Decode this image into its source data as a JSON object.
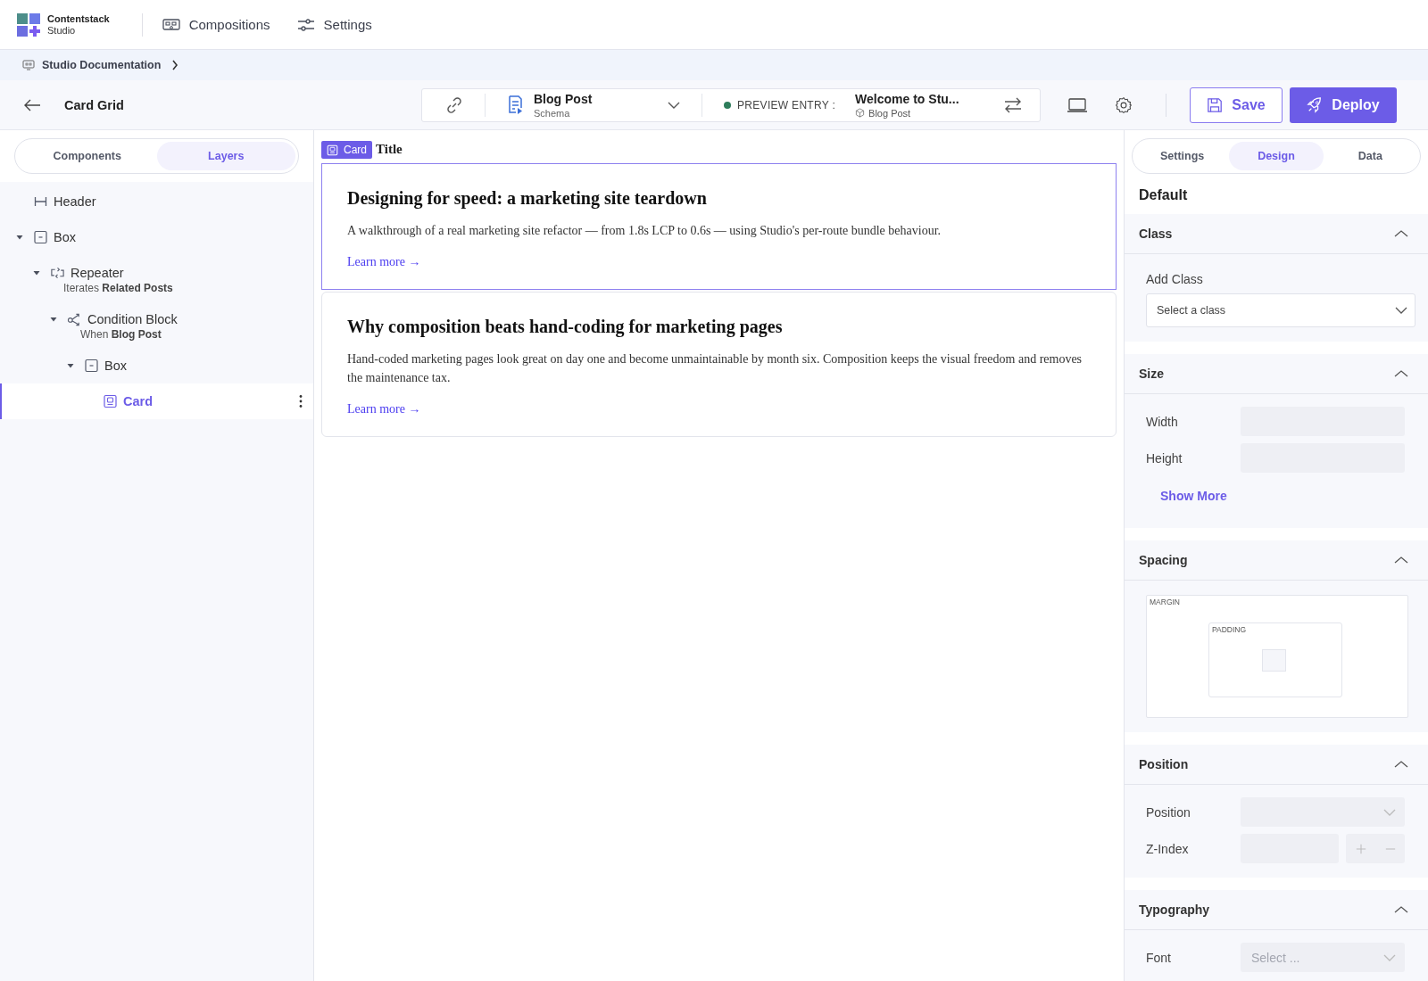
{
  "topnav": {
    "logo": {
      "name": "Contentstack",
      "product": "Studio"
    },
    "items": [
      {
        "label": "Compositions",
        "kind": "compositions"
      },
      {
        "label": "Settings",
        "kind": "settings"
      }
    ]
  },
  "breadcrumb": {
    "label": "Studio Documentation"
  },
  "toolbar": {
    "title": "Card Grid",
    "schema": {
      "name": "Blog Post",
      "type": "Schema"
    },
    "preview": {
      "label": "PREVIEW ENTRY :",
      "entry": "Welcome to Stu...",
      "type": "Blog Post"
    },
    "buttons": [
      {
        "label": "Save",
        "kind": "secondary"
      },
      {
        "label": "Deploy",
        "kind": "primary"
      }
    ]
  },
  "left_panel": {
    "tabs": [
      {
        "label": "Components",
        "selected": false
      },
      {
        "label": "Layers",
        "selected": true
      }
    ],
    "layers": [
      {
        "label": "Header",
        "kind": "header",
        "selected": false
      },
      {
        "label": "Box",
        "kind": "box",
        "selected": false,
        "expanded": true,
        "children": [
          {
            "label": "Repeater",
            "kind": "repeater",
            "selected": false,
            "expanded": true,
            "subtitle": "Iterates **Related Posts**",
            "children": [
              {
                "label": "Condition Block",
                "kind": "condition",
                "selected": false,
                "expanded": true,
                "subtitle": "When **Blog Post**",
                "children": [
                  {
                    "label": "Box",
                    "kind": "box",
                    "selected": false,
                    "expanded": true,
                    "children": [
                      {
                        "label": "Card",
                        "kind": "card",
                        "selected": true
                      }
                    ]
                  }
                ]
              }
            ]
          }
        ]
      }
    ]
  },
  "canvas": {
    "heading": "Title",
    "badge": "Card",
    "cards": [
      {
        "title": "Designing for speed: a marketing site teardown",
        "body": "A walkthrough of a real marketing site refactor — from 1.8s LCP to 0.6s — using Studio's per-route bundle behaviour.",
        "link": "Learn more →",
        "selected": true
      },
      {
        "title": "Why composition beats hand-coding for marketing pages",
        "body": "Hand-coded marketing pages look great on day one and become unmaintainable by month six. Composition keeps the visual freedom and removes the maintenance tax.",
        "link": "Learn more →",
        "selected": false
      }
    ]
  },
  "right_panel": {
    "tabs": [
      {
        "label": "Settings",
        "selected": false
      },
      {
        "label": "Design",
        "selected": true
      },
      {
        "label": "Data",
        "selected": false
      }
    ],
    "state": "Default",
    "sections": [
      {
        "title": "Class",
        "expanded": true,
        "fields": [
          {
            "kind": "select",
            "label": "Add Class",
            "placeholder": "Select a class"
          }
        ]
      },
      {
        "title": "Size",
        "expanded": true,
        "fields": [
          {
            "kind": "input",
            "label": "Width"
          },
          {
            "kind": "input",
            "label": "Height"
          },
          {
            "kind": "link",
            "label": "Show More"
          }
        ]
      },
      {
        "title": "Spacing",
        "expanded": true,
        "fields": [
          {
            "kind": "box_model",
            "outer": "MARGIN",
            "inner": "PADDING"
          }
        ]
      },
      {
        "title": "Position",
        "expanded": true,
        "fields": [
          {
            "kind": "select_inline",
            "label": "Position"
          },
          {
            "kind": "stepper",
            "label": "Z-Index"
          }
        ]
      },
      {
        "title": "Typography",
        "expanded": true,
        "fields": [
          {
            "kind": "select_inline",
            "label": "Font",
            "placeholder": "Select ..."
          }
        ]
      }
    ]
  }
}
